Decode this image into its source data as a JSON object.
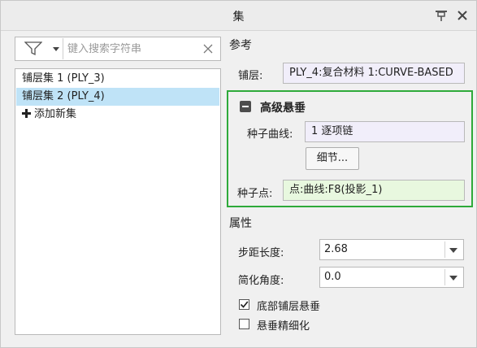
{
  "window": {
    "title": "集"
  },
  "search": {
    "placeholder": "键入搜索字符串"
  },
  "sets": {
    "items": [
      {
        "label": "铺层集 1 (PLY_3)",
        "selected": false
      },
      {
        "label": "铺层集 2 (PLY_4)",
        "selected": true
      }
    ],
    "add_label": "添加新集"
  },
  "reference": {
    "title": "参考",
    "ply_label": "铺层:",
    "ply_value": "PLY_4:复合材料 1:CURVE-BASED"
  },
  "advanced_drape": {
    "title": "高级悬垂",
    "seed_curve_label": "种子曲线:",
    "seed_curve_value": "1 逐项链",
    "details_button": "细节...",
    "seed_point_label": "种子点:",
    "seed_point_value": "点:曲线:F8(投影_1)",
    "accent_color": "#2eaa3a"
  },
  "properties": {
    "title": "属性",
    "step_length_label": "步距长度:",
    "step_length_value": "2.68",
    "simplify_angle_label": "简化角度:",
    "simplify_angle_value": "0.0",
    "bottom_ply_drape_label": "底部铺层悬垂",
    "bottom_ply_drape_checked": true,
    "drape_refine_label": "悬垂精细化",
    "drape_refine_checked": false
  }
}
